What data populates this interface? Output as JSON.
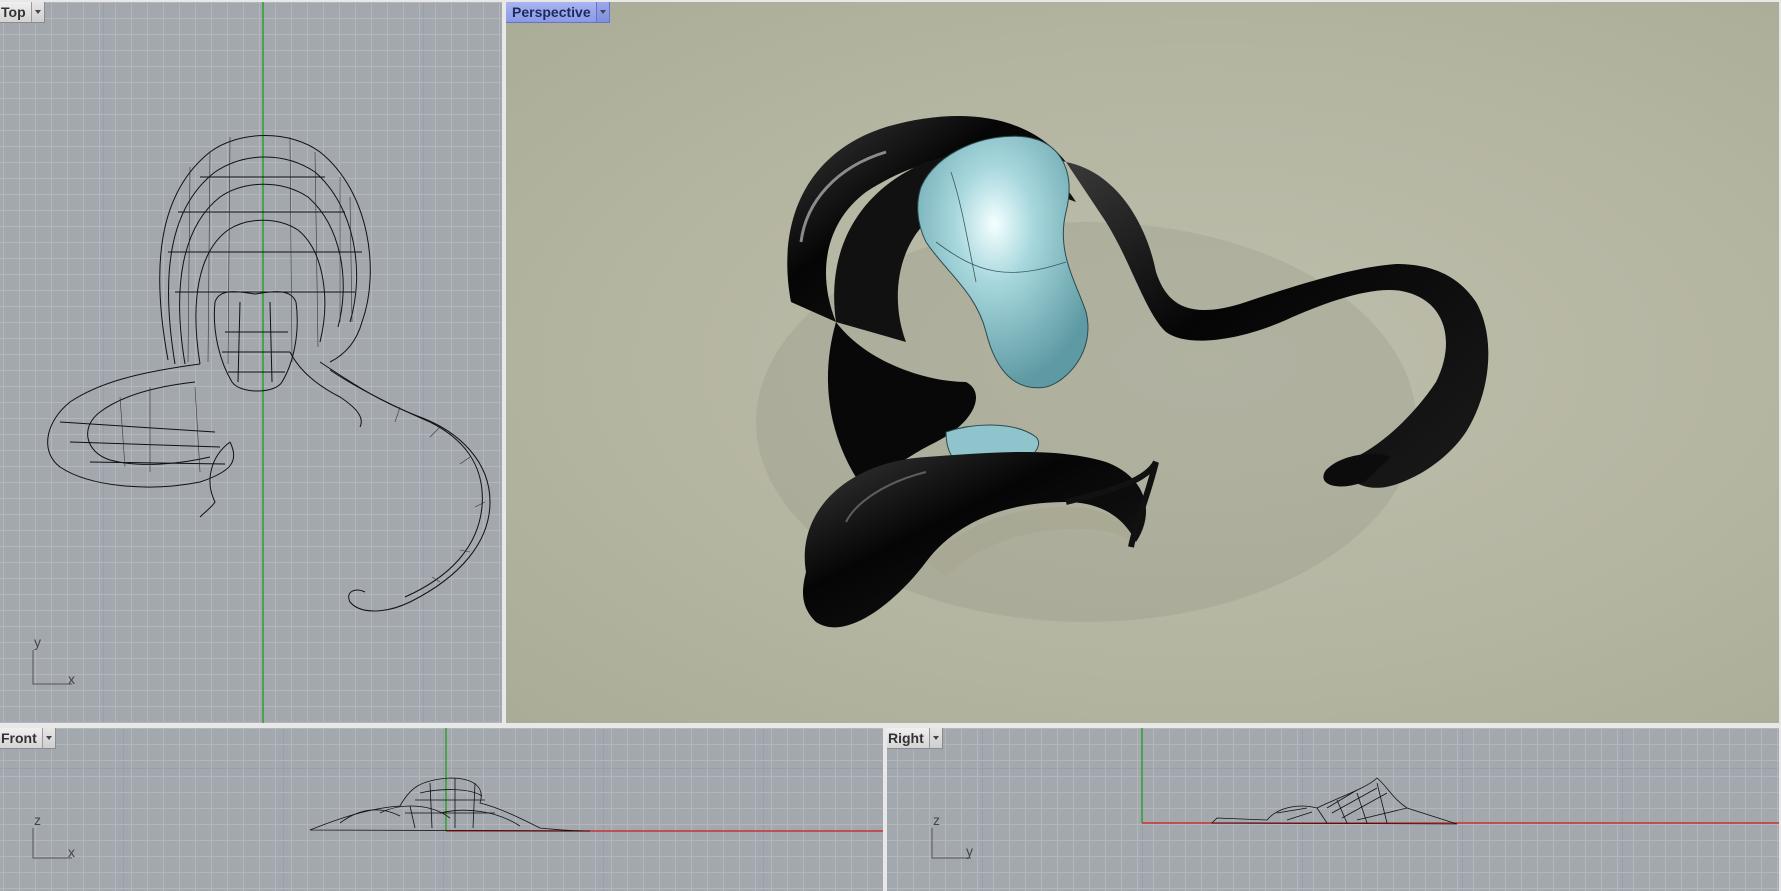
{
  "viewports": {
    "top": {
      "label": "Top",
      "axis_v": "y",
      "axis_h": "x"
    },
    "perspective": {
      "label": "Perspective"
    },
    "front": {
      "label": "Front",
      "axis_v": "z",
      "axis_h": "x"
    },
    "right": {
      "label": "Right",
      "axis_v": "z",
      "axis_h": "y"
    }
  },
  "colors": {
    "viewport_bg": "#a3a8ae",
    "perspective_bg": "#b4b5a1",
    "active_tab": "#8c9ae6",
    "y_axis": "#2fa12f",
    "x_axis": "#c83232",
    "glass": "#8fc4cc",
    "shell": "#0a0a0a"
  },
  "icons": [
    "dropdown-arrow-icon"
  ]
}
